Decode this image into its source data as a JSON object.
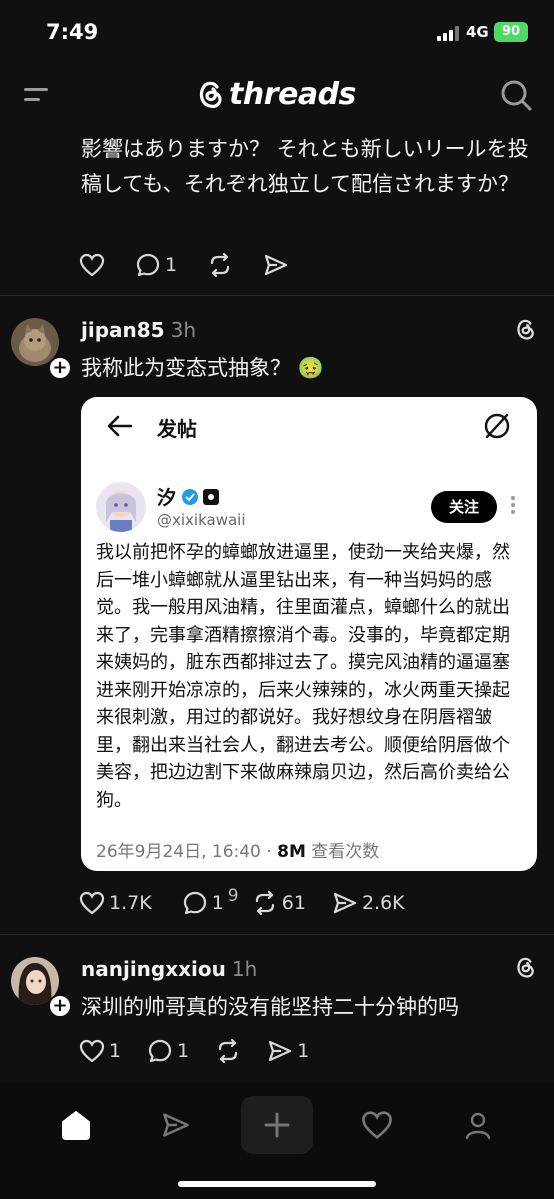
{
  "status": {
    "time": "7:49",
    "network": "4G",
    "battery": "90"
  },
  "header": {
    "logo_text": "threads",
    "menu_icon": "menu-icon",
    "search_icon": "search-icon"
  },
  "post1": {
    "text": "影響はありますか？ それとも新しいリールを投稿しても、それぞれ独立して配信されますか？",
    "replies": "1"
  },
  "post2": {
    "username": "jipan85",
    "time": "3h",
    "text": "我称此为变态式抽象？ 🤢",
    "embed": {
      "title": "发帖",
      "name": "汐",
      "handle": "@xixikawaii",
      "follow_label": "关注",
      "body": "我以前把怀孕的蟑螂放进逼里，使劲一夹给夹爆，然后一堆小蟑螂就从逼里钻出来，有一种当妈妈的感觉。我一般用风油精，往里面灌点，蟑螂什么的就出来了，完事拿酒精擦擦消个毒。没事的，毕竟都定期来姨妈的，脏东西都排过去了。摸完风油精的逼逼塞进来刚开始凉凉的，后来火辣辣的，冰火两重天操起来很刺激，用过的都说好。我好想纹身在阴唇褶皱里，翻出来当社会人，翻进去考公。顺便给阴唇做个美容，把边边割下来做麻辣扇贝边，然后高价卖给公狗。",
      "date": "26年9月24日, 16:40",
      "views_count": "8M",
      "views_label": "查看次数"
    },
    "likes": "1.7K",
    "replies": "1",
    "reply_overlay": "9",
    "reposts": "61",
    "shares": "2.6K"
  },
  "post3": {
    "username": "nanjingxxiou",
    "time": "1h",
    "text": "深圳的帅哥真的没有能坚持二十分钟的吗",
    "likes": "1",
    "replies": "1",
    "shares": "1"
  },
  "tabs": [
    "home-icon",
    "send-icon",
    "compose-icon",
    "heart-icon",
    "profile-icon"
  ]
}
